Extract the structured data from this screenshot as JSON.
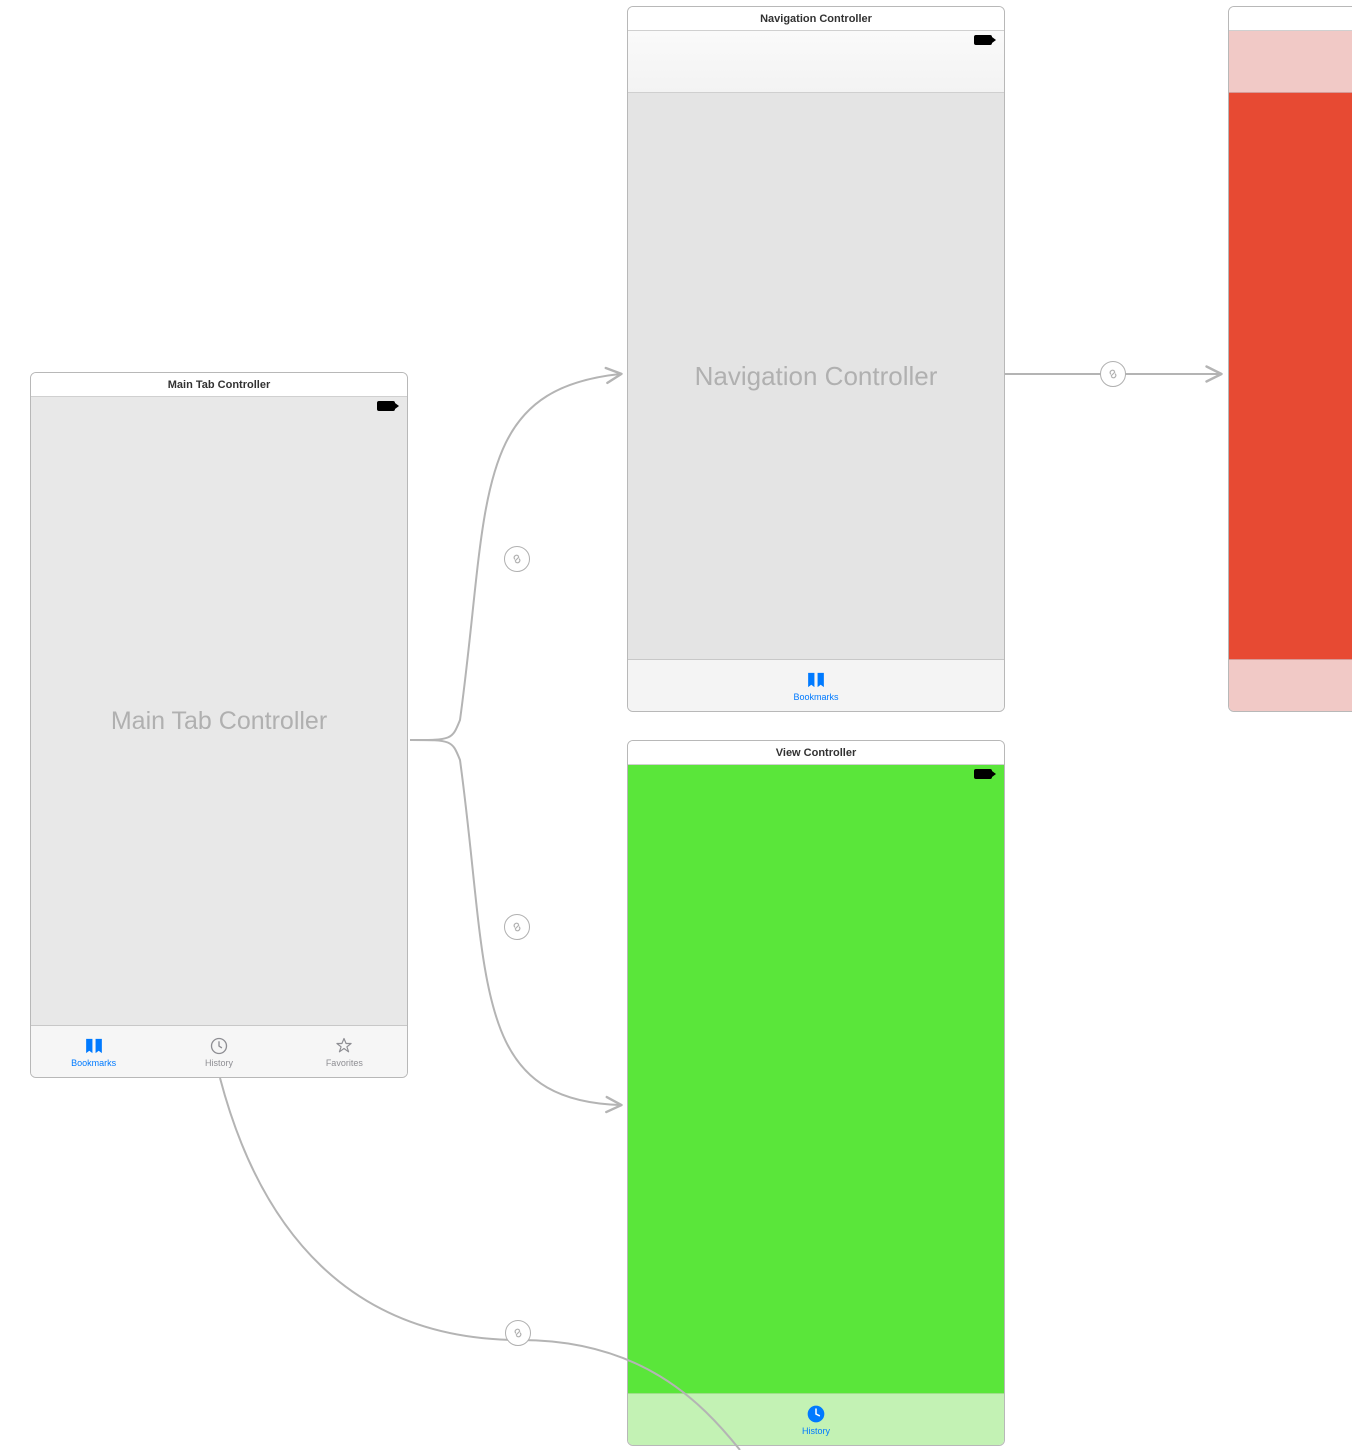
{
  "scenes": {
    "main_tab": {
      "title": "Main Tab Controller",
      "placeholder": "Main Tab Controller"
    },
    "nav": {
      "title": "Navigation Controller",
      "placeholder": "Navigation Controller"
    },
    "view_green": {
      "title": "View Controller"
    },
    "view_red": {
      "title": ""
    }
  },
  "tabs": {
    "bookmarks": "Bookmarks",
    "history": "History",
    "favorites": "Favorites"
  },
  "colors": {
    "tint_active": "#007aff",
    "tint_inactive": "#8e8e93",
    "green": "#5ae63a",
    "green_light": "#c3f2b4",
    "red": "#e74a33",
    "red_light": "#f1c9c6"
  },
  "icons": {
    "bookmarks": "bookmarks-icon",
    "history": "history-icon",
    "favorites": "favorites-icon",
    "segue": "link-icon"
  }
}
